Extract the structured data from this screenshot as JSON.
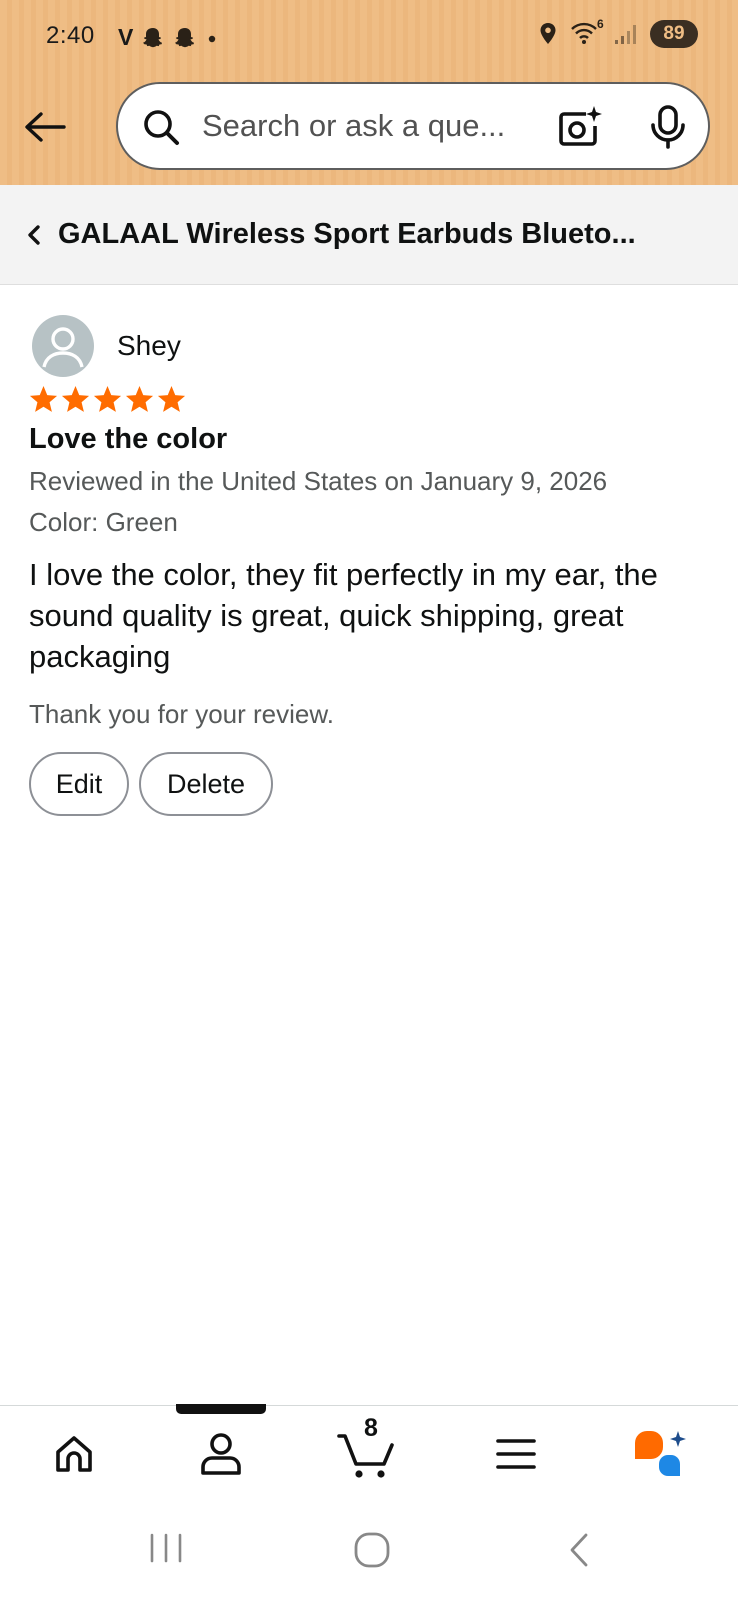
{
  "status_bar": {
    "time": "2:40",
    "carrier_glyph": "V",
    "battery": "89",
    "network_type": "6",
    "icons": [
      "snapchat-ghost-icon",
      "snapchat-ghost-icon",
      "dot-icon",
      "location-pin-icon",
      "wifi-icon",
      "signal-icon"
    ]
  },
  "search": {
    "placeholder": "Search or ask a que...",
    "icons": [
      "back-arrow-icon",
      "search-icon",
      "camera-lens-icon",
      "microphone-icon"
    ]
  },
  "breadcrumb": {
    "title": "GALAAL Wireless Sport Earbuds Blueto..."
  },
  "review": {
    "reviewer": "Shey",
    "rating": 5,
    "rating_max": 5,
    "title": "Love the color",
    "date_line": "Reviewed in the United States on January 9, 2026",
    "variant": "Color: Green",
    "body": "I love the color, they fit perfectly in my ear, the sound quality is great, quick shipping, great packaging",
    "thanks": "Thank you for your review.",
    "edit_label": "Edit",
    "delete_label": "Delete"
  },
  "tabbar": {
    "cart_count": "8",
    "active_tab": "account",
    "tabs": [
      "home-icon",
      "account-icon",
      "cart-icon",
      "menu-icon",
      "rufus-ai-icon"
    ]
  },
  "colors": {
    "header_bg": "#efbd85",
    "star": "#ff6c00",
    "text": "#0f1111",
    "secondary_text": "#565959",
    "rufus_orange": "#ff6a00",
    "rufus_blue": "#1e88e5"
  }
}
